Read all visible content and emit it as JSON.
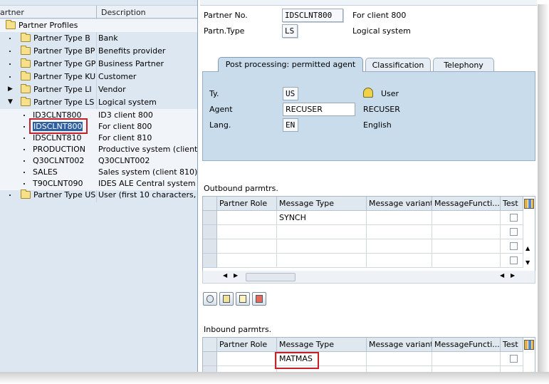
{
  "tree": {
    "columns": {
      "partner": "artner",
      "description": "Description"
    },
    "root": "Partner Profiles",
    "items": [
      {
        "name": "Partner Type B",
        "desc": "Bank",
        "level": 1,
        "expander": ""
      },
      {
        "name": "Partner Type BP",
        "desc": "Benefits provider",
        "level": 1,
        "expander": ""
      },
      {
        "name": "Partner Type GP",
        "desc": "Business Partner",
        "level": 1,
        "expander": ""
      },
      {
        "name": "Partner Type KU",
        "desc": "Customer",
        "level": 1,
        "expander": ""
      },
      {
        "name": "Partner Type LI",
        "desc": "Vendor",
        "level": 1,
        "expander": "▶"
      },
      {
        "name": "Partner Type LS",
        "desc": "Logical system",
        "level": 1,
        "expander": "▼"
      },
      {
        "name": "ID3CLNT800",
        "desc": "ID3 client 800",
        "level": 2
      },
      {
        "name": "IDSCLNT800",
        "desc": "For client 800",
        "level": 2,
        "selected": true
      },
      {
        "name": "IDSCLNT810",
        "desc": "For client 810",
        "level": 2
      },
      {
        "name": "PRODUCTION",
        "desc": "Productive system (client",
        "level": 2
      },
      {
        "name": "Q30CLNT002",
        "desc": "Q30CLNT002",
        "level": 2
      },
      {
        "name": "SALES",
        "desc": "Sales system (client 810)",
        "level": 2
      },
      {
        "name": "T90CLNT090",
        "desc": "IDES ALE Central system",
        "level": 2
      },
      {
        "name": "Partner Type US",
        "desc": "User (first 10 characters,",
        "level": 1,
        "expander": ""
      }
    ]
  },
  "header": {
    "partner_no_label": "Partner No.",
    "partner_no_value": "IDSCLNT800",
    "partner_no_desc": "For client 800",
    "partn_type_label": "Partn.Type",
    "partn_type_value": "LS",
    "partn_type_desc": "Logical system"
  },
  "tabs": [
    {
      "label": "Post processing: permitted agent",
      "active": true
    },
    {
      "label": "Classification",
      "active": false
    },
    {
      "label": "Telephony",
      "active": false
    }
  ],
  "agent_panel": {
    "ty_label": "Ty.",
    "ty_value": "US",
    "ty_desc": "User",
    "agent_label": "Agent",
    "agent_value": "RECUSER",
    "agent_desc": "RECUSER",
    "lang_label": "Lang.",
    "lang_value": "EN",
    "lang_desc": "English"
  },
  "outbound": {
    "title": "Outbound parmtrs.",
    "columns": [
      "Partner Role",
      "Message Type",
      "Message variant",
      "MessageFuncti...",
      "Test"
    ],
    "rows": [
      [
        "",
        "SYNCH",
        "",
        "",
        ""
      ],
      [
        "",
        "",
        "",
        "",
        ""
      ],
      [
        "",
        "",
        "",
        "",
        ""
      ],
      [
        "",
        "",
        "",
        "",
        ""
      ]
    ]
  },
  "inbound": {
    "title": "Inbound parmtrs.",
    "columns": [
      "Partner Role",
      "Message Type",
      "Message variant",
      "MessageFuncti...",
      "Test"
    ],
    "rows": [
      [
        "",
        "MATMAS",
        "",
        "",
        ""
      ]
    ]
  },
  "toolbar_icons": [
    "details-icon",
    "copy-icon",
    "create-icon",
    "delete-icon"
  ],
  "colors": {
    "selection": "#2f5f9e",
    "highlight_box": "#c8202a",
    "tab_panel": "#c8dceb",
    "tree_bg": "#dde7f1"
  }
}
